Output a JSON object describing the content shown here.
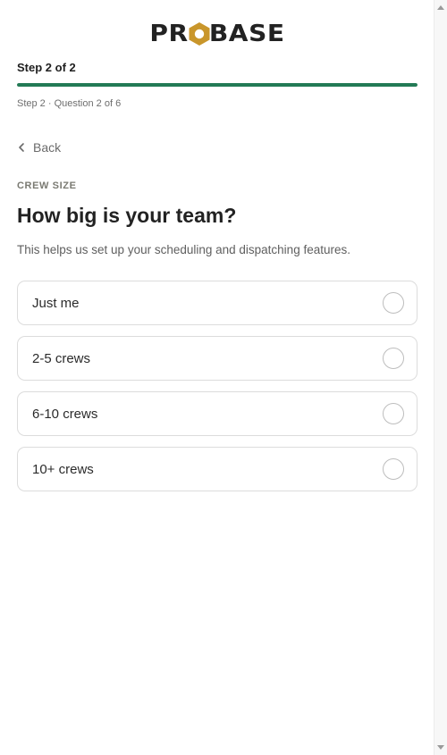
{
  "logo": {
    "left": "PR",
    "right": "BASE"
  },
  "step": {
    "title": "Step 2 of 2",
    "progress": 1.0,
    "subtitle": "Step 2 · Question 2 of 6"
  },
  "back_label": "Back",
  "question": {
    "eyebrow": "CREW SIZE",
    "title": "How big is your team?",
    "description": "This helps us set up your scheduling and dispatching features."
  },
  "options": [
    {
      "label": "Just me"
    },
    {
      "label": "2-5 crews"
    },
    {
      "label": "6-10 crews"
    },
    {
      "label": "10+ crews"
    }
  ],
  "colors": {
    "accent": "#237a55",
    "logo_gold": "#c9962b",
    "logo_dark": "#222222"
  }
}
